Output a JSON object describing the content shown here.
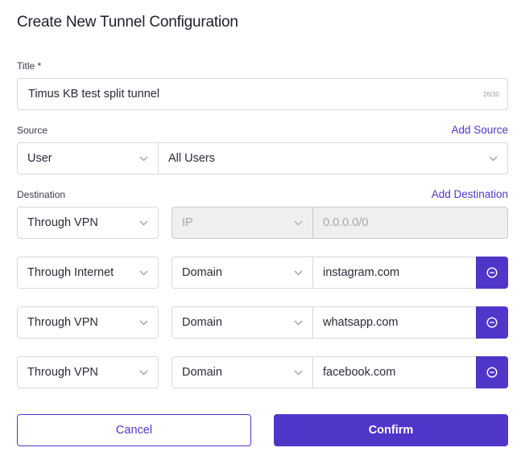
{
  "dialog": {
    "title": "Create New Tunnel Configuration"
  },
  "title_field": {
    "label": "Title *",
    "value": "Timus KB test split tunnel",
    "counter": "26/30"
  },
  "source": {
    "label": "Source",
    "add_label": "Add Source",
    "type": "User",
    "value": "All Users"
  },
  "destination": {
    "label": "Destination",
    "add_label": "Add Destination",
    "rows": [
      {
        "route": "Through VPN",
        "kind": "IP",
        "value": "0.0.0.0/0",
        "disabled": true
      },
      {
        "route": "Through Internet",
        "kind": "Domain",
        "value": "instagram.com",
        "disabled": false
      },
      {
        "route": "Through VPN",
        "kind": "Domain",
        "value": "whatsapp.com",
        "disabled": false
      },
      {
        "route": "Through VPN",
        "kind": "Domain",
        "value": "facebook.com",
        "disabled": false
      }
    ]
  },
  "actions": {
    "cancel_label": "Cancel",
    "confirm_label": "Confirm"
  },
  "colors": {
    "accent": "#4f36c9",
    "border": "#d8d8de",
    "disabled_bg": "#efefef"
  },
  "icons": {
    "chevron": "chevron-down-icon",
    "remove": "minus-circle-icon"
  }
}
